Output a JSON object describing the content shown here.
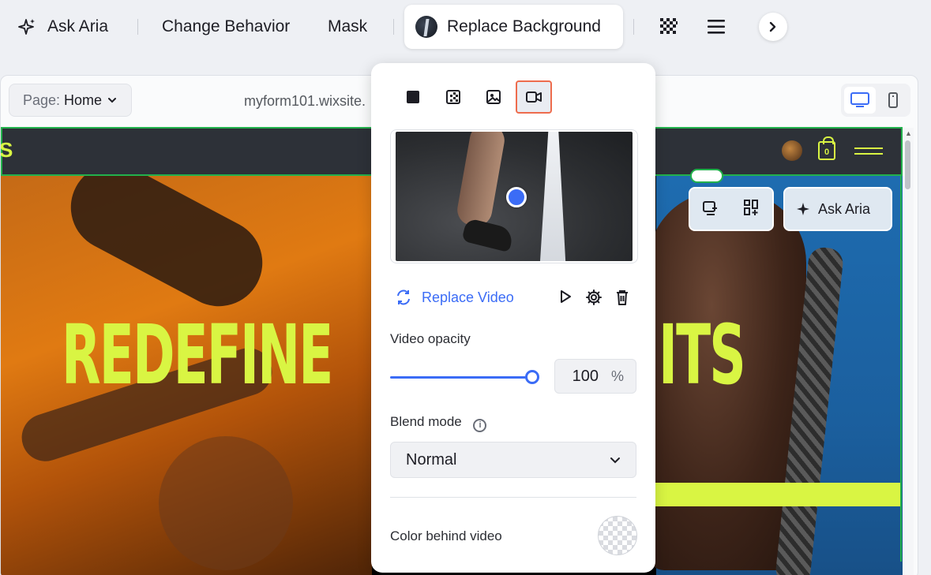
{
  "toolbar": {
    "ask_aria": "Ask Aria",
    "change_behavior": "Change Behavior",
    "mask": "Mask",
    "replace_background": "Replace Background"
  },
  "editor": {
    "page_label": "Page:",
    "page_value": "Home",
    "url": "myform101.wixsite."
  },
  "site": {
    "hero_left_text": "REDEFINE",
    "hero_right_text": "ITS",
    "cart_count": "0",
    "float_ask_aria": "Ask Aria"
  },
  "panel": {
    "replace_video": "Replace Video",
    "video_opacity_label": "Video opacity",
    "opacity_value": "100",
    "opacity_unit": "%",
    "opacity_fraction": 1.0,
    "blend_mode_label": "Blend mode",
    "blend_mode_value": "Normal",
    "color_behind_label": "Color behind video",
    "active_bg_type": "video"
  },
  "colors": {
    "accent": "#3b6cf6",
    "brand_lime": "#d9f543",
    "selection_green": "#22b14c",
    "active_tab_border": "#ee6c4d"
  }
}
